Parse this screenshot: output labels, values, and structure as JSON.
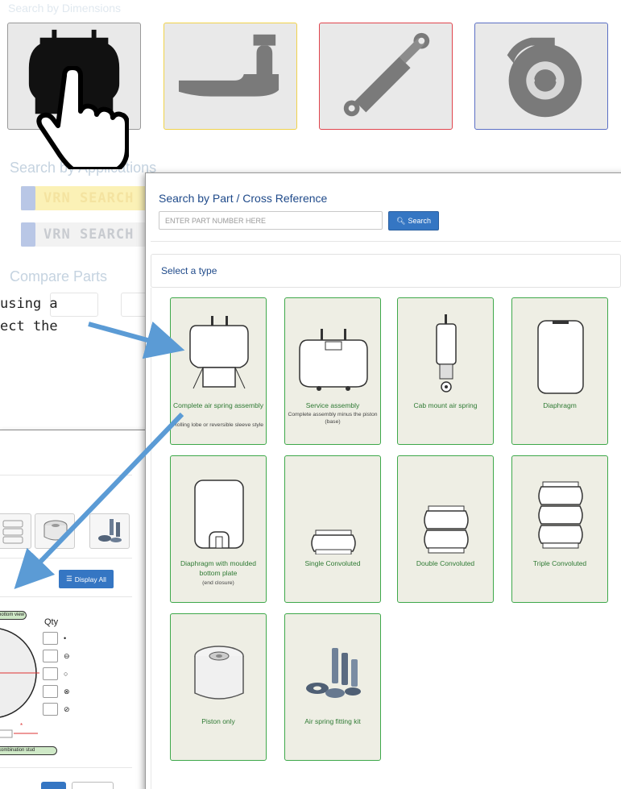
{
  "background": {
    "dimensions_heading": "Search by Dimensions",
    "applications_heading": "Search by Applications",
    "vrn_button_1": "VRN SEARCH",
    "vrn_button_2": "VRN SEARCH",
    "compare_heading": "Compare Parts",
    "intro_text": "using a\nect the"
  },
  "panel": {
    "title": "Search by Part / Cross Reference",
    "input_placeholder": "ENTER PART NUMBER HERE",
    "search_label": "Search",
    "select_type_label": "Select a type",
    "types": [
      {
        "label": "Complete air spring assembly",
        "sub": "Rolling lobe or reversible sleeve style"
      },
      {
        "label": "Service assembly",
        "sub": "Complete assembly minus the piston (base)"
      },
      {
        "label": "Cab mount air spring",
        "sub": ""
      },
      {
        "label": "Diaphragm",
        "sub": ""
      },
      {
        "label": "Diaphragm with moulded bottom plate",
        "sub": "(end closure)"
      },
      {
        "label": "Single Convoluted",
        "sub": ""
      },
      {
        "label": "Double Convoluted",
        "sub": ""
      },
      {
        "label": "Triple Convoluted",
        "sub": ""
      },
      {
        "label": "Piston only",
        "sub": ""
      },
      {
        "label": "Air spring fitting kit",
        "sub": ""
      }
    ]
  },
  "secondary_window": {
    "display_all_label": "Display All",
    "qty_label": "Qty",
    "view_pill": "bottom view",
    "stud_pill": "combination stud",
    "symbols": [
      "•",
      "⊖",
      "○",
      "⊗",
      "⊘"
    ]
  },
  "colors": {
    "accent_blue": "#3576c3",
    "card_border_green": "#3ea84a",
    "card_bg": "#eeeee4",
    "arrow_blue": "#5b9bd5"
  }
}
